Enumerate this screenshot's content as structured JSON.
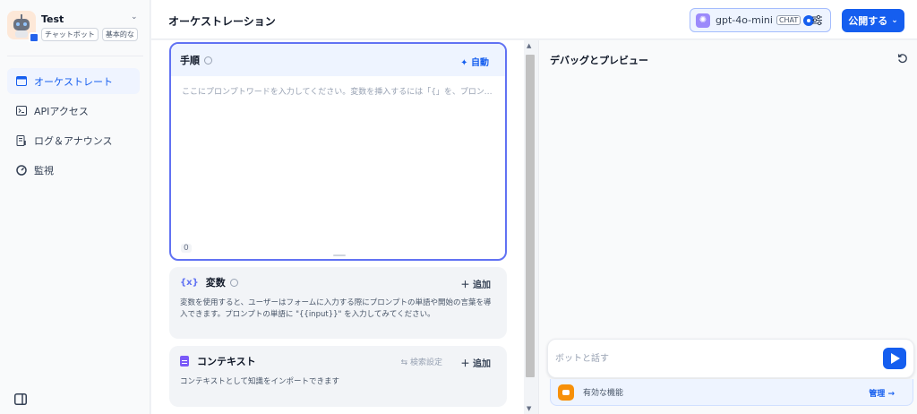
{
  "app": {
    "name": "Test",
    "tags": [
      "チャットボット",
      "基本的な"
    ]
  },
  "sidebar": {
    "items": [
      {
        "label": "オーケストレート",
        "icon": "layout-icon",
        "active": true
      },
      {
        "label": "APIアクセス",
        "icon": "terminal-icon",
        "active": false
      },
      {
        "label": "ログ＆アナウンス",
        "icon": "log-icon",
        "active": false
      },
      {
        "label": "監視",
        "icon": "monitor-icon",
        "active": false
      }
    ]
  },
  "header": {
    "title": "オーケストレーション",
    "model": {
      "name": "gpt-4o-mini",
      "mode": "CHAT"
    },
    "publish_label": "公開する"
  },
  "prompt": {
    "title": "手順",
    "auto_label": "自動",
    "placeholder": "ここにプロンプトワードを入力してください。変数を挿入するには「{」を、プロンプトコンテ...",
    "count": "0"
  },
  "variables": {
    "title": "変数",
    "add_label": "追加",
    "description": "変数を使用すると、ユーザーはフォームに入力する際にプロンプトの単語や開始の言葉を導入できます。プロンプトの単語に \"{{input}}\" を入力してみてください。"
  },
  "context": {
    "title": "コンテキスト",
    "search_label": "検索設定",
    "add_label": "追加",
    "description": "コンテキストとして知識をインポートできます"
  },
  "debug": {
    "title": "デバッグとプレビュー",
    "chat_placeholder": "ボットと話す",
    "features_label": "有効な機能",
    "manage_label": "管理"
  },
  "colors": {
    "accent": "#155eef",
    "prompt_border": "#6172f3",
    "feature_icon": "#f79009"
  }
}
